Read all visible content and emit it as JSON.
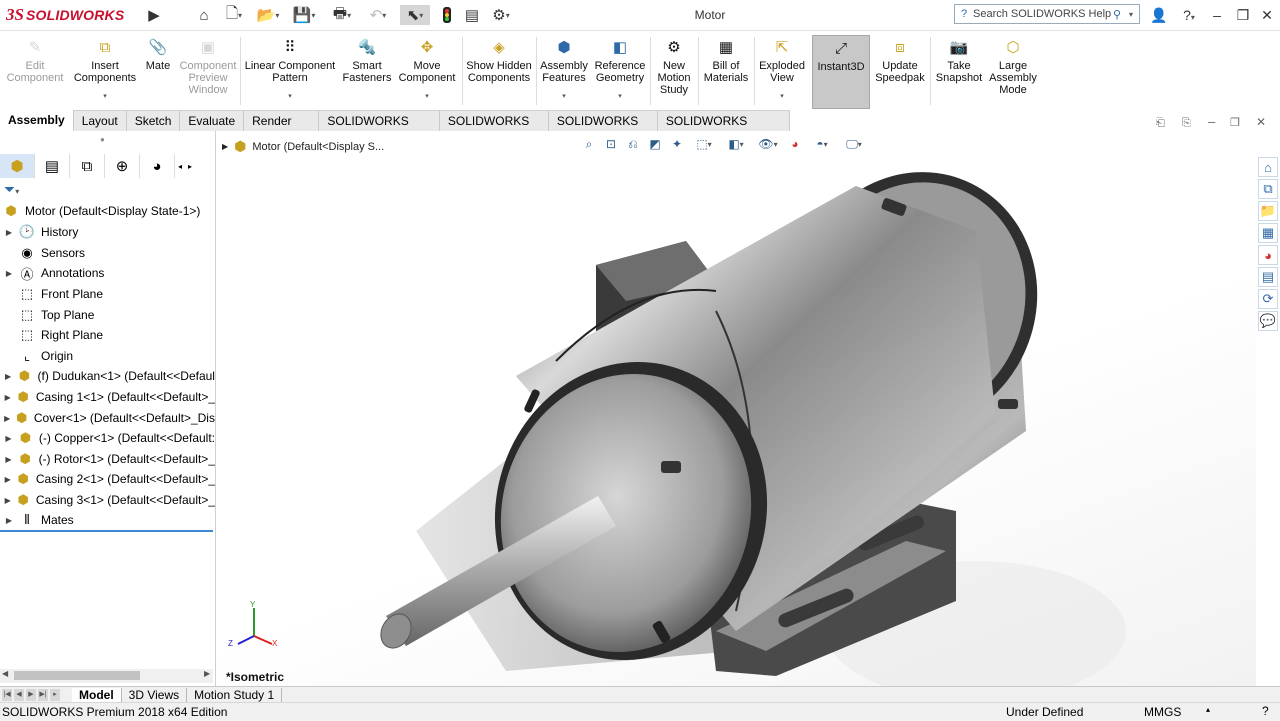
{
  "app": {
    "brand_prefix": "3S",
    "brand_name": "SOLIDWORKS",
    "window_title": "Motor",
    "help_search_placeholder": "Search SOLIDWORKS Help"
  },
  "ribbon": {
    "buttons": [
      {
        "label": "Edit Component",
        "icon": "edit-component-icon",
        "enabled": false
      },
      {
        "label": "Insert Components",
        "icon": "insert-components-icon",
        "enabled": true
      },
      {
        "label": "Mate",
        "icon": "mate-icon",
        "enabled": true
      },
      {
        "label": "Component Preview Window",
        "icon": "component-preview-icon",
        "enabled": false
      },
      {
        "label": "Linear Component Pattern",
        "icon": "linear-pattern-icon",
        "enabled": true
      },
      {
        "label": "Smart Fasteners",
        "icon": "smart-fasteners-icon",
        "enabled": true
      },
      {
        "label": "Move Component",
        "icon": "move-component-icon",
        "enabled": true
      },
      {
        "label": "Show Hidden Components",
        "icon": "show-hidden-icon",
        "enabled": true
      },
      {
        "label": "Assembly Features",
        "icon": "assembly-features-icon",
        "enabled": true
      },
      {
        "label": "Reference Geometry",
        "icon": "reference-geometry-icon",
        "enabled": true
      },
      {
        "label": "New Motion Study",
        "icon": "motion-study-icon",
        "enabled": true
      },
      {
        "label": "Bill of Materials",
        "icon": "bom-icon",
        "enabled": true
      },
      {
        "label": "Exploded View",
        "icon": "exploded-view-icon",
        "enabled": true
      },
      {
        "label": "Instant3D",
        "icon": "instant3d-icon",
        "enabled": true,
        "active": true
      },
      {
        "label": "Update Speedpak",
        "icon": "speedpak-icon",
        "enabled": true
      },
      {
        "label": "Take Snapshot",
        "icon": "snapshot-icon",
        "enabled": true
      },
      {
        "label": "Large Assembly Mode",
        "icon": "large-assembly-icon",
        "enabled": true
      }
    ]
  },
  "command_tabs": [
    "Assembly",
    "Layout",
    "Sketch",
    "Evaluate",
    "Render Tools",
    "SOLIDWORKS Add-Ins",
    "SOLIDWORKS MBD",
    "SOLIDWORKS CAM",
    "SOLIDWORKS Inspection"
  ],
  "feature_tree": {
    "root": "Motor  (Default<Display State-1>)",
    "items": [
      {
        "label": "History",
        "icon": "history-icon",
        "expandable": true
      },
      {
        "label": "Sensors",
        "icon": "sensors-icon",
        "expandable": false
      },
      {
        "label": "Annotations",
        "icon": "annotations-icon",
        "expandable": true
      },
      {
        "label": "Front Plane",
        "icon": "plane-icon",
        "expandable": false
      },
      {
        "label": "Top Plane",
        "icon": "plane-icon",
        "expandable": false
      },
      {
        "label": "Right Plane",
        "icon": "plane-icon",
        "expandable": false
      },
      {
        "label": "Origin",
        "icon": "origin-icon",
        "expandable": false
      },
      {
        "label": "(f) Dudukan<1> (Default<<Defaul",
        "icon": "part-icon",
        "expandable": true
      },
      {
        "label": "Casing 1<1> (Default<<Default>_",
        "icon": "part-icon",
        "expandable": true
      },
      {
        "label": "Cover<1> (Default<<Default>_Dis",
        "icon": "part-icon",
        "expandable": true
      },
      {
        "label": "(-) Copper<1> (Default<<Default:",
        "icon": "part-icon",
        "expandable": true
      },
      {
        "label": "(-) Rotor<1> (Default<<Default>_",
        "icon": "part-icon",
        "expandable": true
      },
      {
        "label": "Casing 2<1> (Default<<Default>_",
        "icon": "part-icon",
        "expandable": true
      },
      {
        "label": "Casing 3<1> (Default<<Default>_",
        "icon": "part-icon",
        "expandable": true
      },
      {
        "label": "Mates",
        "icon": "mates-icon",
        "expandable": true
      }
    ]
  },
  "viewport": {
    "breadcrumb": "Motor  (Default<Display S...",
    "view_name": "*Isometric",
    "triad": {
      "x": "X",
      "y": "Y",
      "z": "Z"
    }
  },
  "bottom_tabs": [
    "Model",
    "3D Views",
    "Motion Study 1"
  ],
  "status": {
    "edition": "SOLIDWORKS Premium 2018 x64 Edition",
    "state": "Under Defined",
    "units": "MMGS"
  }
}
